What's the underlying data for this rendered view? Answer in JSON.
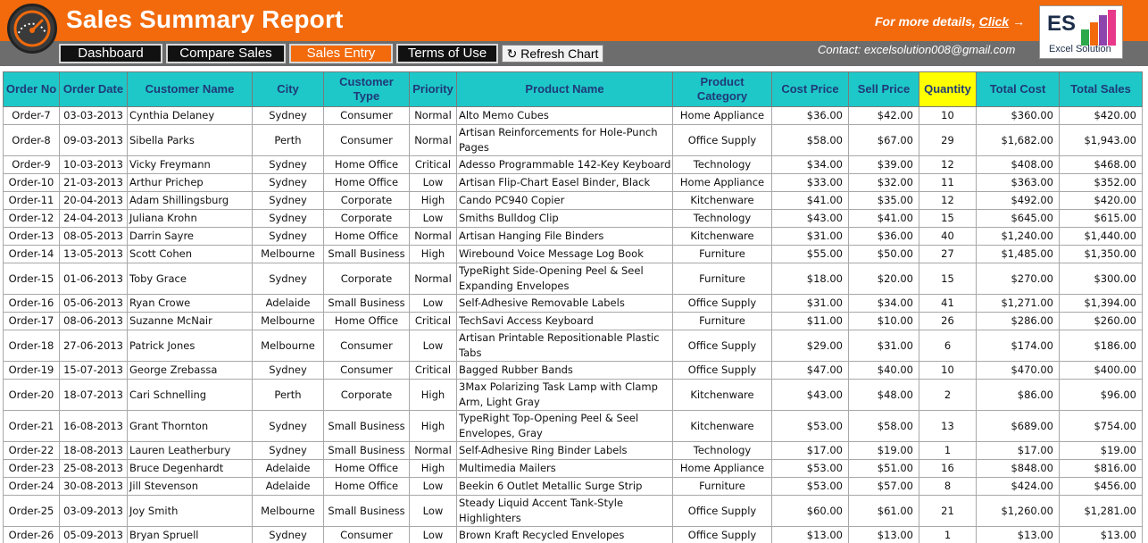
{
  "header": {
    "title": "Sales Summary Report",
    "more_text": "For more details, ",
    "more_link": "Click",
    "more_arrow": "→",
    "contact": "Contact: excelsolution008@gmail.com",
    "logo_text": "ES",
    "logo_caption": "Excel Solution",
    "colors": {
      "header_bg": "#f26a0c",
      "subbar_bg": "#6d6d6d",
      "table_header_bg": "#1ec8c8",
      "quantity_header_bg": "#ffff00"
    }
  },
  "nav": {
    "dashboard": "Dashboard",
    "compare": "Compare Sales",
    "entry": "Sales Entry",
    "terms": "Terms of Use",
    "refresh_icon": "↻",
    "refresh": "Refresh Chart",
    "active": "Sales Entry"
  },
  "table": {
    "columns": [
      "Order No",
      "Order Date",
      "Customer Name",
      "City",
      "Customer Type",
      "Priority",
      "Product Name",
      "Product Category",
      "Cost Price",
      "Sell Price",
      "Quantity",
      "Total Cost",
      "Total Sales"
    ],
    "rows": [
      [
        "Order-7",
        "03-03-2013",
        "Cynthia Delaney",
        "Sydney",
        "Consumer",
        "Normal",
        "Alto Memo Cubes",
        "Home Appliance",
        "$36.00",
        "$42.00",
        "10",
        "$360.00",
        "$420.00"
      ],
      [
        "Order-8",
        "09-03-2013",
        "Sibella Parks",
        "Perth",
        "Consumer",
        "Normal",
        "Artisan Reinforcements for Hole-Punch Pages",
        "Office Supply",
        "$58.00",
        "$67.00",
        "29",
        "$1,682.00",
        "$1,943.00"
      ],
      [
        "Order-9",
        "10-03-2013",
        "Vicky Freymann",
        "Sydney",
        "Home Office",
        "Critical",
        "Adesso Programmable 142-Key Keyboard",
        "Technology",
        "$34.00",
        "$39.00",
        "12",
        "$408.00",
        "$468.00"
      ],
      [
        "Order-10",
        "21-03-2013",
        "Arthur Prichep",
        "Sydney",
        "Home Office",
        "Low",
        "Artisan Flip-Chart Easel Binder, Black",
        "Home Appliance",
        "$33.00",
        "$32.00",
        "11",
        "$363.00",
        "$352.00"
      ],
      [
        "Order-11",
        "20-04-2013",
        "Adam Shillingsburg",
        "Sydney",
        "Corporate",
        "High",
        "Cando PC940 Copier",
        "Kitchenware",
        "$41.00",
        "$35.00",
        "12",
        "$492.00",
        "$420.00"
      ],
      [
        "Order-12",
        "24-04-2013",
        "Juliana Krohn",
        "Sydney",
        "Corporate",
        "Low",
        "Smiths Bulldog Clip",
        "Technology",
        "$43.00",
        "$41.00",
        "15",
        "$645.00",
        "$615.00"
      ],
      [
        "Order-13",
        "08-05-2013",
        "Darrin Sayre",
        "Sydney",
        "Home Office",
        "Normal",
        "Artisan Hanging File Binders",
        "Kitchenware",
        "$31.00",
        "$36.00",
        "40",
        "$1,240.00",
        "$1,440.00"
      ],
      [
        "Order-14",
        "13-05-2013",
        "Scott Cohen",
        "Melbourne",
        "Small Business",
        "High",
        "Wirebound Voice Message Log Book",
        "Furniture",
        "$55.00",
        "$50.00",
        "27",
        "$1,485.00",
        "$1,350.00"
      ],
      [
        "Order-15",
        "01-06-2013",
        "Toby Grace",
        "Sydney",
        "Corporate",
        "Normal",
        "TypeRight Side-Opening Peel & Seel Expanding Envelopes",
        "Furniture",
        "$18.00",
        "$20.00",
        "15",
        "$270.00",
        "$300.00"
      ],
      [
        "Order-16",
        "05-06-2013",
        "Ryan Crowe",
        "Adelaide",
        "Small Business",
        "Low",
        "Self-Adhesive Removable Labels",
        "Office Supply",
        "$31.00",
        "$34.00",
        "41",
        "$1,271.00",
        "$1,394.00"
      ],
      [
        "Order-17",
        "08-06-2013",
        "Suzanne McNair",
        "Melbourne",
        "Home Office",
        "Critical",
        "TechSavi Access Keyboard",
        "Furniture",
        "$11.00",
        "$10.00",
        "26",
        "$286.00",
        "$260.00"
      ],
      [
        "Order-18",
        "27-06-2013",
        "Patrick Jones",
        "Melbourne",
        "Consumer",
        "Low",
        "Artisan Printable Repositionable Plastic Tabs",
        "Office Supply",
        "$29.00",
        "$31.00",
        "6",
        "$174.00",
        "$186.00"
      ],
      [
        "Order-19",
        "15-07-2013",
        "George Zrebassa",
        "Sydney",
        "Consumer",
        "Critical",
        "Bagged Rubber Bands",
        "Office Supply",
        "$47.00",
        "$40.00",
        "10",
        "$470.00",
        "$400.00"
      ],
      [
        "Order-20",
        "18-07-2013",
        "Cari Schnelling",
        "Perth",
        "Corporate",
        "High",
        "3Max Polarizing Task Lamp with Clamp Arm, Light Gray",
        "Kitchenware",
        "$43.00",
        "$48.00",
        "2",
        "$86.00",
        "$96.00"
      ],
      [
        "Order-21",
        "16-08-2013",
        "Grant Thornton",
        "Sydney",
        "Small Business",
        "High",
        "TypeRight  Top-Opening Peel & Seel Envelopes, Gray",
        "Kitchenware",
        "$53.00",
        "$58.00",
        "13",
        "$689.00",
        "$754.00"
      ],
      [
        "Order-22",
        "18-08-2013",
        "Lauren Leatherbury",
        "Sydney",
        "Small Business",
        "Normal",
        "Self-Adhesive Ring Binder Labels",
        "Technology",
        "$17.00",
        "$19.00",
        "1",
        "$17.00",
        "$19.00"
      ],
      [
        "Order-23",
        "25-08-2013",
        "Bruce Degenhardt",
        "Adelaide",
        "Home Office",
        "High",
        "Multimedia Mailers",
        "Home Appliance",
        "$53.00",
        "$51.00",
        "16",
        "$848.00",
        "$816.00"
      ],
      [
        "Order-24",
        "30-08-2013",
        "Jill Stevenson",
        "Adelaide",
        "Home Office",
        "Low",
        "Beekin 6 Outlet Metallic Surge Strip",
        "Furniture",
        "$53.00",
        "$57.00",
        "8",
        "$424.00",
        "$456.00"
      ],
      [
        "Order-25",
        "03-09-2013",
        "Joy Smith",
        "Melbourne",
        "Small Business",
        "Low",
        "Steady Liquid Accent Tank-Style Highlighters",
        "Office Supply",
        "$60.00",
        "$61.00",
        "21",
        "$1,260.00",
        "$1,281.00"
      ],
      [
        "Order-26",
        "05-09-2013",
        "Bryan Spruell",
        "Sydney",
        "Consumer",
        "Low",
        "Brown Kraft Recycled Envelopes",
        "Office Supply",
        "$13.00",
        "$13.00",
        "1",
        "$13.00",
        "$13.00"
      ]
    ]
  }
}
